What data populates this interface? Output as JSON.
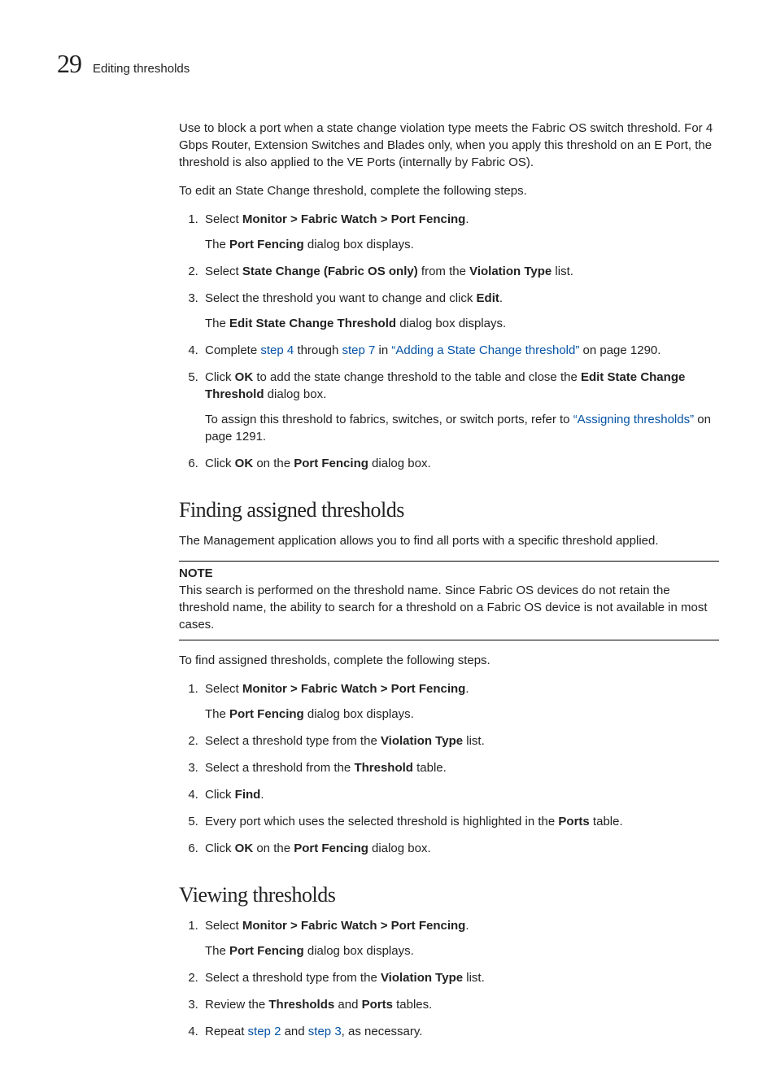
{
  "header": {
    "chapter_number": "29",
    "section_title": "Editing thresholds"
  },
  "intro": {
    "p1": "Use to block a port when a state change violation type meets the Fabric OS switch threshold. For 4 Gbps Router, Extension Switches and Blades only, when you apply this threshold on an E Port, the threshold is also applied to the VE Ports (internally by Fabric OS).",
    "p2": "To edit an State Change threshold, complete the following steps."
  },
  "editSteps": {
    "s1": {
      "prefix": "Select ",
      "bold1": "Monitor > Fabric Watch > Port Fencing",
      "suffix1": ".",
      "sub_prefix": "The ",
      "sub_bold": "Port Fencing",
      "sub_suffix": " dialog box displays."
    },
    "s2": {
      "prefix": "Select ",
      "bold1": "State Change (Fabric OS only)",
      "mid1": " from the ",
      "bold2": "Violation Type",
      "suffix": " list."
    },
    "s3": {
      "prefix": "Select the threshold you want to change and click ",
      "bold1": "Edit",
      "suffix": ".",
      "sub_prefix": "The ",
      "sub_bold": "Edit State Change Threshold",
      "sub_suffix": " dialog box displays."
    },
    "s4": {
      "prefix": "Complete ",
      "link1": "step 4",
      "mid1": " through ",
      "link2": "step 7",
      "mid2": " in ",
      "link3": "“Adding a State Change threshold”",
      "suffix": " on page 1290."
    },
    "s5": {
      "prefix": "Click ",
      "bold1": "OK",
      "mid1": " to add the state change threshold to the table and close the ",
      "bold2": "Edit State Change Threshold",
      "suffix": " dialog box.",
      "sub_prefix": "To assign this threshold to fabrics, switches, or switch ports, refer to ",
      "sub_link": "“Assigning thresholds”",
      "sub_suffix": " on page 1291."
    },
    "s6": {
      "prefix": "Click ",
      "bold1": "OK",
      "mid1": " on the ",
      "bold2": "Port Fencing",
      "suffix": " dialog box."
    }
  },
  "finding": {
    "heading": "Finding assigned thresholds",
    "p1": "The Management application allows you to find all ports with a specific threshold applied.",
    "note_label": "NOTE",
    "note_body": "This search is performed on the threshold name. Since Fabric OS devices do not retain the threshold name, the ability to search for a threshold on a Fabric OS device is not available in most cases.",
    "p2": "To find assigned thresholds, complete the following steps."
  },
  "findingSteps": {
    "s1": {
      "prefix": "Select ",
      "bold1": "Monitor > Fabric Watch > Port Fencing",
      "suffix": ".",
      "sub_prefix": "The ",
      "sub_bold": "Port Fencing",
      "sub_suffix": " dialog box displays."
    },
    "s2": {
      "prefix": "Select a threshold type from the ",
      "bold1": "Violation Type",
      "suffix": " list."
    },
    "s3": {
      "prefix": "Select a threshold from the ",
      "bold1": "Threshold",
      "suffix": " table."
    },
    "s4": {
      "prefix": "Click ",
      "bold1": "Find",
      "suffix": "."
    },
    "s5": {
      "prefix": "Every port which uses the selected threshold is highlighted in the ",
      "bold1": "Ports",
      "suffix": " table."
    },
    "s6": {
      "prefix": "Click ",
      "bold1": "OK",
      "mid1": " on the ",
      "bold2": "Port Fencing",
      "suffix": " dialog box."
    }
  },
  "viewing": {
    "heading": "Viewing thresholds"
  },
  "viewingSteps": {
    "s1": {
      "prefix": "Select ",
      "bold1": "Monitor > Fabric Watch > Port Fencing",
      "suffix": ".",
      "sub_prefix": "The ",
      "sub_bold": "Port Fencing",
      "sub_suffix": " dialog box displays."
    },
    "s2": {
      "prefix": "Select a threshold type from the ",
      "bold1": "Violation Type",
      "suffix": " list."
    },
    "s3": {
      "prefix": "Review the ",
      "bold1": "Thresholds",
      "mid1": " and ",
      "bold2": "Ports",
      "suffix": " tables."
    },
    "s4": {
      "prefix": "Repeat ",
      "link1": "step 2",
      "mid1": " and ",
      "link2": "step 3",
      "suffix": ", as necessary."
    }
  }
}
